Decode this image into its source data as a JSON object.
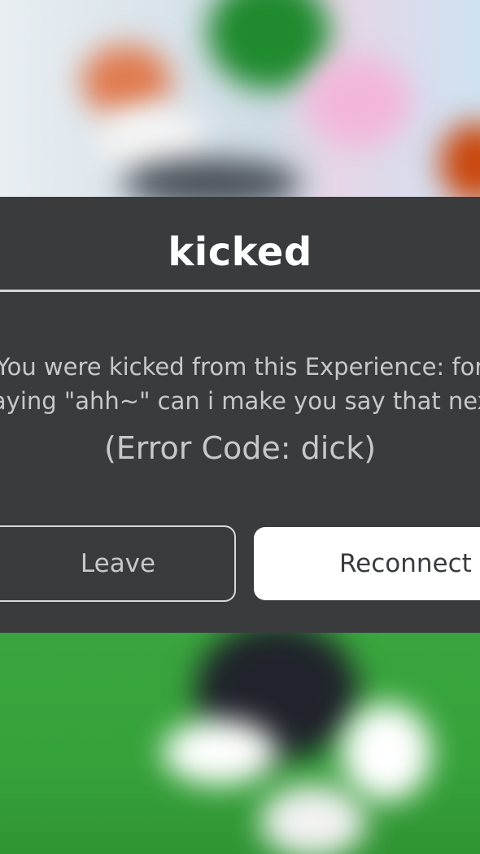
{
  "dialog": {
    "title": "kicked",
    "message_line1": "You were kicked from this Experience: for",
    "message_line2": "saying \"ahh~\" can i make you say that next",
    "error_code": "(Error Code: dick)"
  },
  "buttons": {
    "leave_label": "Leave",
    "reconnect_label": "Reconnect"
  },
  "colors": {
    "dialog_bg": "#393b3d",
    "title_text": "#ffffff",
    "body_text": "#c7c8c9",
    "reconnect_bg": "#ffffff"
  }
}
